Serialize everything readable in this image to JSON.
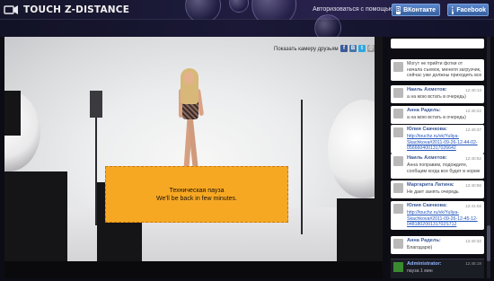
{
  "header": {
    "logo_text": "TOUCH Z-DISTANCE",
    "login_text": "Авторизоваться с помощью",
    "vk_label": "ВКонтакте",
    "fb_label": "Facebook",
    "accent": "#3d6bb3"
  },
  "video": {
    "show_friends_label": "Показать камеру друзьям",
    "share_icons": [
      "facebook-icon",
      "vk-icon",
      "twitter-icon",
      "email-icon"
    ],
    "pause": {
      "line1": "Техническая пауза",
      "line2": "We'll be back in few minutes.",
      "color": "#f7a823"
    }
  },
  "chat": {
    "messages": [
      {
        "author": "",
        "time": "",
        "body": ""
      },
      {
        "author": "",
        "time": "",
        "body": "Могут не прийти фотки от\nначала съемок, менеля загрузчик,\nсейчас уже должны приходить все"
      },
      {
        "author": "Наиль Ахметов:",
        "time": "12:40:13",
        "body": "а на мою встать в очередь)"
      },
      {
        "author": "Анна Радель:",
        "time": "12:40:22",
        "body": "а на мою встать в очередь)"
      },
      {
        "author": "Юлия Скачкова:",
        "time": "12:40:37",
        "body": "http://touchz.ru/vk/Yuliya-\nSkachkova#2011-09-26-12-44-02-\n0566604001317026642",
        "link": true
      },
      {
        "author": "Наиль Ахметов:",
        "time": "12:40:52",
        "body": "Анна поправим, подождите,\nсообщим когда все будет в норме"
      },
      {
        "author": "Маргарита Латина:",
        "time": "12:40:56",
        "body": "Не дает занять очередь"
      },
      {
        "author": "Юлия Скачкова:",
        "time": "12:41:02",
        "body": "http://touchz.ru/vk/Yuliya-\nSkachkova#2011-09-26-12-45-12-\n048180200131702S712",
        "link": true
      },
      {
        "author": "Анна Радель:",
        "time": "12:40:32",
        "body": "Благодарю)"
      }
    ],
    "admin": {
      "author": "Administrator:",
      "time": "12:45:19",
      "body": "пауза 1 мин"
    }
  }
}
